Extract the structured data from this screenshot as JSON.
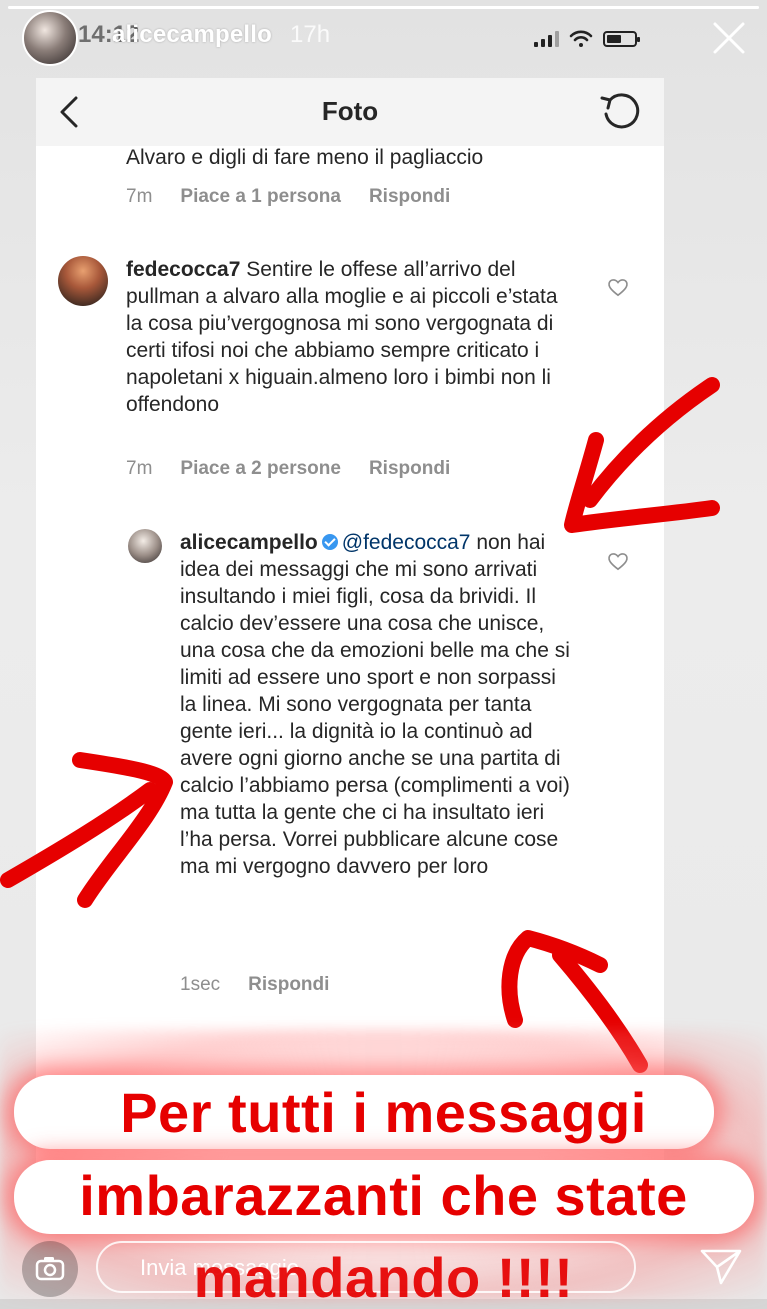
{
  "story": {
    "username": "alicecampello",
    "time_ago": "17h",
    "status_time": "14:12",
    "progress_fraction": 1.0
  },
  "post_screen": {
    "title": "Foto",
    "previous_comment": {
      "text_tail": "Alvaro e digli di fare meno il pagliaccio",
      "age": "7m",
      "likes": "Piace a 1 persona",
      "reply_label": "Rispondi"
    },
    "comment_1": {
      "username": "fedecocca7",
      "text": "Sentire le offese all’arrivo del pullman a alvaro alla moglie e ai piccoli e’stata la cosa piu’vergognosa mi sono vergognata di certi tifosi noi che abbiamo sempre criticato i napoletani x higuain.almeno loro i bimbi non li offendono",
      "age": "7m",
      "likes": "Piace a 2 persone",
      "reply_label": "Rispondi"
    },
    "reply_1": {
      "username": "alicecampello",
      "mention": "@fedecocca7",
      "text": "non hai idea dei messaggi che mi sono arrivati insultando i miei figli, cosa da brividi. Il calcio dev’essere una cosa che unisce, una cosa che da emozioni belle ma che si limiti ad essere uno sport e non sorpassi la linea. Mi sono vergognata per tanta gente ieri... la dignità io la continuò ad avere ogni giorno anche se una partita di calcio l’abbiamo persa (complimenti a voi) ma tutta la gente che ci ha insultato ieri l’ha persa. Vorrei pubblicare alcune cose ma mi vergogno davvero per loro",
      "age": "1sec",
      "reply_label": "Rispondi"
    }
  },
  "caption": {
    "line_1": "Per tutti i messaggi",
    "line_2": "imbarazzanti che state",
    "line_3": "mandando !!!!"
  },
  "reply_bar": {
    "placeholder": "Invia messaggio"
  },
  "colors": {
    "annotation_red": "#e60000",
    "verified_blue": "#3897f0",
    "mention_blue": "#003569",
    "meta_gray": "#8e8e8e"
  },
  "icons": [
    "close-icon",
    "back-chevron-icon",
    "refresh-icon",
    "heart-icon",
    "verified-badge-icon",
    "camera-icon",
    "send-icon"
  ]
}
